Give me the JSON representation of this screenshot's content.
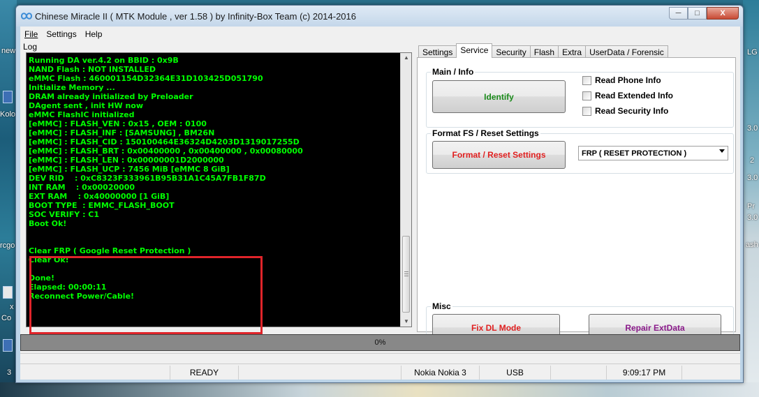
{
  "window": {
    "title": "Chinese Miracle II ( MTK Module , ver 1.58 ) by Infinity-Box Team (c) 2014-2016",
    "minimize_label": "─",
    "maximize_label": "□",
    "close_label": "X"
  },
  "desktop": {
    "labels": [
      "new",
      "Kolo",
      "rcgo",
      "x",
      "Co",
      "3",
      "LG",
      "3.0",
      "2",
      "3.0",
      "Pr",
      "3.0",
      "ash"
    ]
  },
  "menu": {
    "items": [
      {
        "label": "File"
      },
      {
        "label": "Settings"
      },
      {
        "label": "Help"
      }
    ]
  },
  "log": {
    "label": "Log",
    "lines": [
      "Running DA ver.4.2 on BBID : 0x9B",
      "NAND Flash : NOT INSTALLED",
      "eMMC Flash : 460001154D32364E31D103425D051790",
      "Initialize Memory ...",
      "DRAM already initialized by Preloader",
      "DAgent sent , init HW now",
      "eMMC FlashIC initialized",
      "[eMMC] : FLASH_VEN : 0x15 , OEM : 0100",
      "[eMMC] : FLASH_INF : [SAMSUNG] , BM26N",
      "[eMMC] : FLASH_CID : 150100464E36324D4203D1319017255D",
      "[eMMC] : FLASH_BRT : 0x00400000 , 0x00400000 , 0x00080000",
      "[eMMC] : FLASH_LEN : 0x00000001D2000000",
      "[eMMC] : FLASH_UCP : 7456 MiB [eMMC 8 GiB]",
      "DEV RID    : 0xC8323F333961B95B31A1C45A7FB1F87D",
      "INT RAM    : 0x00020000",
      "EXT RAM    : 0x40000000 [1 GiB]",
      "BOOT TYPE  : EMMC_FLASH_BOOT",
      "SOC VERIFY : C1",
      "Boot Ok!",
      "",
      "",
      "Clear FRP ( Google Reset Protection )",
      "Clear Ok!",
      "",
      "Done!",
      "Elapsed: 00:00:11",
      "Reconnect Power/Cable!"
    ],
    "highlight_color": "#e0242a"
  },
  "tabs": [
    {
      "label": "Settings",
      "active": false
    },
    {
      "label": "Service",
      "active": true
    },
    {
      "label": "Security",
      "active": false
    },
    {
      "label": "Flash",
      "active": false
    },
    {
      "label": "Extra",
      "active": false
    },
    {
      "label": "UserData / Forensic",
      "active": false
    }
  ],
  "service": {
    "main_info": {
      "title": "Main / Info",
      "identify_label": "Identify",
      "identify_color": "#1a8a1a",
      "checkboxes": [
        {
          "label": "Read Phone Info",
          "checked": false
        },
        {
          "label": "Read Extended Info",
          "checked": false
        },
        {
          "label": "Read Security Info",
          "checked": false
        }
      ]
    },
    "format": {
      "title": "Format FS / Reset Settings",
      "button_label": "Format / Reset Settings",
      "button_color": "#e02020",
      "select_value": "FRP ( RESET PROTECTION )"
    },
    "misc": {
      "title": "Misc",
      "fix_dl_label": "Fix DL Mode",
      "fix_dl_color": "#e02020",
      "repair_label": "Repair ExtData",
      "repair_color": "#8a1a8a"
    }
  },
  "progress": {
    "label": "0%",
    "value": 0
  },
  "status": {
    "state": "READY",
    "device": "Nokia Nokia 3",
    "port": "USB",
    "time": "9:09:17 PM"
  }
}
